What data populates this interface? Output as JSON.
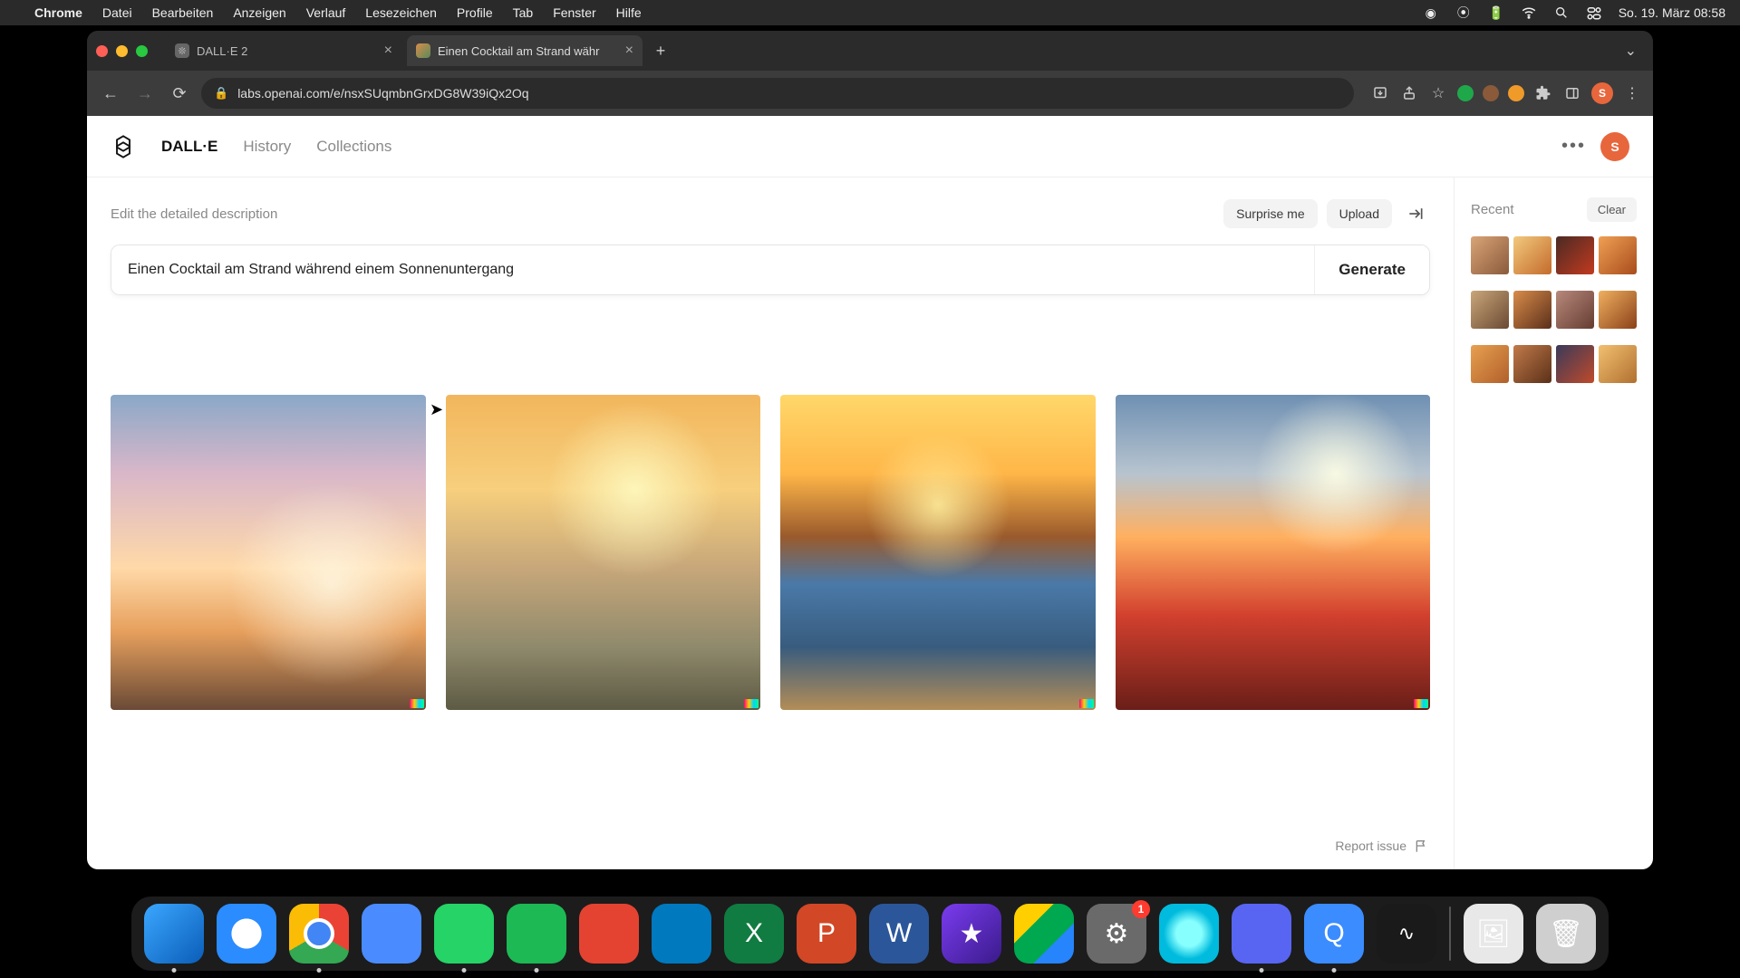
{
  "menubar": {
    "app": "Chrome",
    "items": [
      "Datei",
      "Bearbeiten",
      "Anzeigen",
      "Verlauf",
      "Lesezeichen",
      "Profile",
      "Tab",
      "Fenster",
      "Hilfe"
    ],
    "clock": "So. 19. März  08:58"
  },
  "browser": {
    "tabs": [
      {
        "title": "DALL·E 2"
      },
      {
        "title": "Einen Cocktail am Strand währ"
      }
    ],
    "url": "labs.openai.com/e/nsxSUqmbnGrxDG8W39iQx2Oq"
  },
  "nav": {
    "brand": "DALL·E",
    "links": [
      "History",
      "Collections"
    ],
    "avatar_letter": "S"
  },
  "prompt": {
    "label": "Edit the detailed description",
    "surprise": "Surprise me",
    "upload": "Upload",
    "value": "Einen Cocktail am Strand während einem Sonnenuntergang",
    "generate": "Generate"
  },
  "sidebar": {
    "title": "Recent",
    "clear": "Clear"
  },
  "report": {
    "label": "Report issue"
  },
  "dock": {
    "badge_settings": "1"
  }
}
